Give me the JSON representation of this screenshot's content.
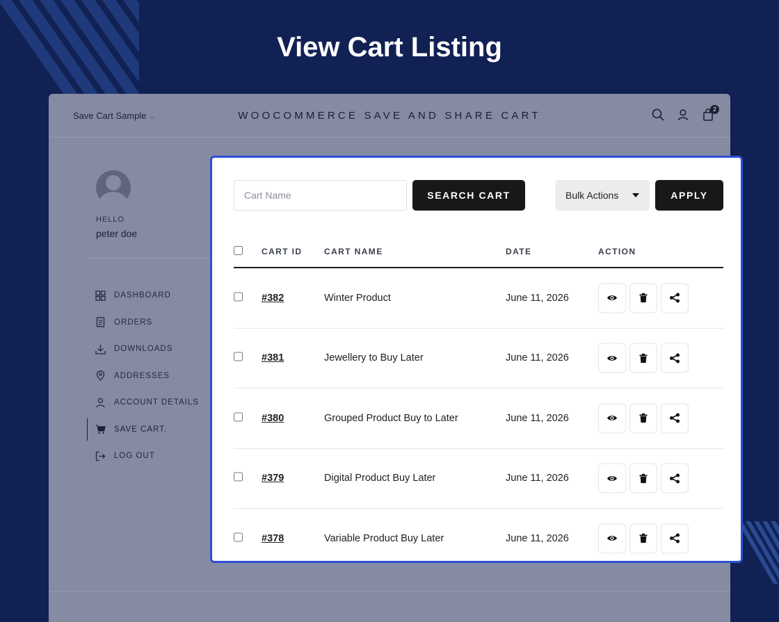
{
  "hero": {
    "title": "View Cart Listing"
  },
  "site": {
    "menu_label": "Save Cart Sample",
    "brand": "WOOCOMMERCE SAVE AND SHARE CART",
    "cart_count": "2"
  },
  "account": {
    "hello": "HELLO",
    "username": "peter doe",
    "nav": [
      {
        "label": "DASHBOARD",
        "icon": "dashboard-icon"
      },
      {
        "label": "ORDERS",
        "icon": "orders-icon"
      },
      {
        "label": "DOWNLOADS",
        "icon": "download-icon"
      },
      {
        "label": "ADDRESSES",
        "icon": "location-icon"
      },
      {
        "label": "ACCOUNT DETAILS",
        "icon": "user-icon"
      },
      {
        "label": "SAVE CART.",
        "icon": "cart-icon",
        "active": true
      },
      {
        "label": "LOG OUT",
        "icon": "logout-icon"
      }
    ]
  },
  "toolbar": {
    "cart_name_placeholder": "Cart Name",
    "search_label": "SEARCH CART",
    "bulk_label": "Bulk Actions",
    "apply_label": "APPLY"
  },
  "table": {
    "headers": {
      "id": "CART ID",
      "name": "CART NAME",
      "date": "DATE",
      "action": "ACTION"
    },
    "rows": [
      {
        "id": "#382",
        "name": "Winter Product",
        "date": "June 11, 2026"
      },
      {
        "id": "#381",
        "name": "Jewellery to Buy Later",
        "date": "June 11, 2026"
      },
      {
        "id": "#380",
        "name": "Grouped Product Buy to Later",
        "date": "June 11, 2026"
      },
      {
        "id": "#379",
        "name": "Digital Product Buy Later",
        "date": "June 11, 2026"
      },
      {
        "id": "#378",
        "name": "Variable Product Buy Later",
        "date": "June 11, 2026"
      }
    ]
  },
  "colors": {
    "background": "#122154",
    "panel_border": "#2e4fd6",
    "button_dark": "#181818"
  }
}
